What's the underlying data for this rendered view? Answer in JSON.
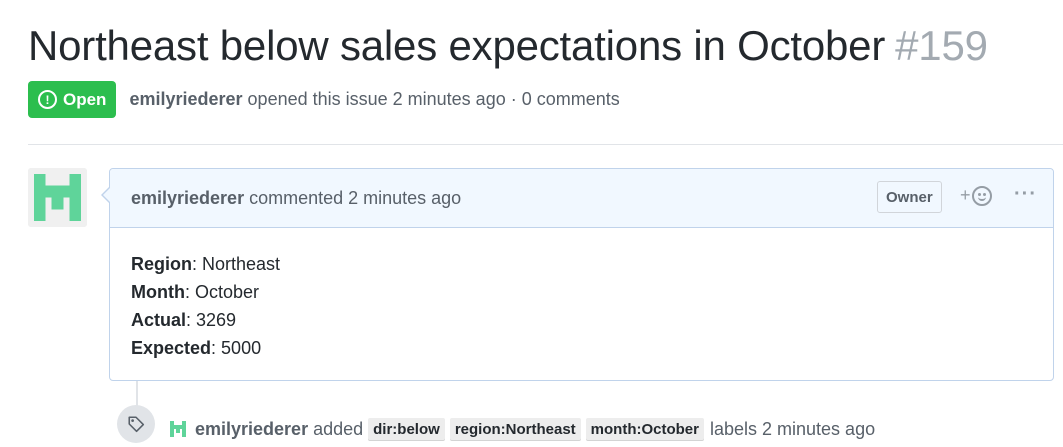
{
  "issue": {
    "title": "Northeast below sales expectations in October",
    "number": "#159",
    "state": "Open",
    "author": "emilyriederer",
    "opened_text": "opened this issue 2 minutes ago · 0 comments"
  },
  "comment": {
    "author": "emilyriederer",
    "time_text": "commented 2 minutes ago",
    "owner_badge": "Owner",
    "reaction_plus": "+",
    "more": "···",
    "fields": [
      {
        "key": "Region",
        "value": ": Northeast"
      },
      {
        "key": "Month",
        "value": ": October"
      },
      {
        "key": "Actual",
        "value": ": 3269"
      },
      {
        "key": "Expected",
        "value": ": 5000"
      }
    ]
  },
  "event": {
    "author": "emilyriederer",
    "action": "added",
    "labels": [
      "dir:below",
      "region:Northeast",
      "month:October"
    ],
    "after": "labels 2 minutes ago"
  },
  "colors": {
    "open_green": "#2cbe4e",
    "avatar_green": "#5fd49a",
    "header_blue": "#f1f8ff"
  },
  "icons": {
    "state": "issue-opened-icon",
    "reaction": "smiley-icon",
    "more": "kebab-horizontal-icon",
    "tag": "tag-icon"
  }
}
